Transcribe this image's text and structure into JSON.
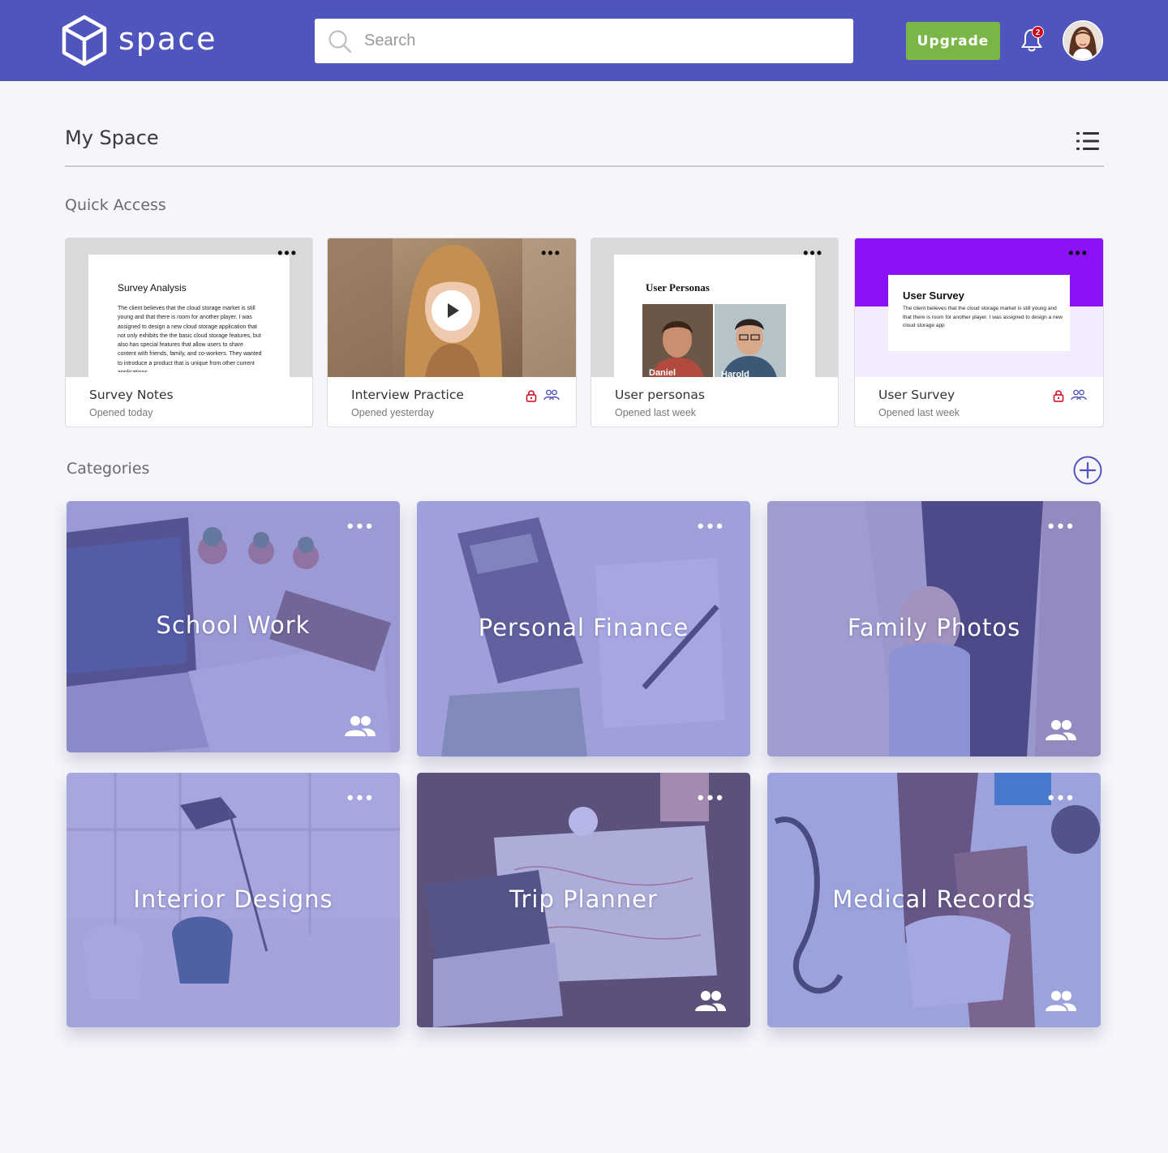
{
  "header": {
    "brand": "space",
    "search_placeholder": "Search",
    "upgrade_label": "Upgrade",
    "notification_count": "2"
  },
  "page": {
    "title": "My Space"
  },
  "quick_access": {
    "title": "Quick Access",
    "items": [
      {
        "name": "Survey Notes",
        "opened": "Opened today",
        "preview_title": "Survey Analysis",
        "preview_text": "The client believes that the cloud storage market is still young and that there is room for another player. I was assigned to design a new cloud storage application that not only exhibits the the basic cloud storage features, but also has special features that allow users to share content with friends, family, and co-workers. They wanted to introduce a product that is unique from other current applications."
      },
      {
        "name": "Interview Practice",
        "opened": "Opened yesterday",
        "locked": true,
        "shared": true
      },
      {
        "name": "User personas",
        "opened": "Opened last week",
        "preview_title": "User Personas",
        "persona_1": "Daniel",
        "persona_2": "Harold"
      },
      {
        "name": "User Survey",
        "opened": "Opened last week",
        "preview_title": "User Survey",
        "preview_text": "The client believes that the cloud storage market is still young and that there is room for another player. I was assigned to design a new cloud storage app",
        "locked": true,
        "shared": true
      }
    ]
  },
  "categories": {
    "title": "Categories",
    "items": [
      {
        "label": "School Work",
        "shared": true
      },
      {
        "label": "Personal Finance",
        "shared": false
      },
      {
        "label": "Family Photos",
        "shared": true
      },
      {
        "label": "Interior Designs",
        "shared": false
      },
      {
        "label": "Trip Planner",
        "shared": true
      },
      {
        "label": "Medical Records",
        "shared": true
      }
    ]
  },
  "colors": {
    "header_bg": "#4f55bd",
    "upgrade_green": "#7ab648",
    "badge_red": "#d0021b",
    "accent_purple": "#8b11f6",
    "overlay_purple": "#6c6ed0"
  },
  "icons": {
    "logo": "cube-icon",
    "search": "search-icon",
    "notifications": "bell-icon",
    "view": "list-view-icon",
    "add": "plus-circle-icon",
    "more": "more-dots-icon",
    "lock": "lock-icon",
    "share": "people-icon",
    "play": "play-icon"
  }
}
